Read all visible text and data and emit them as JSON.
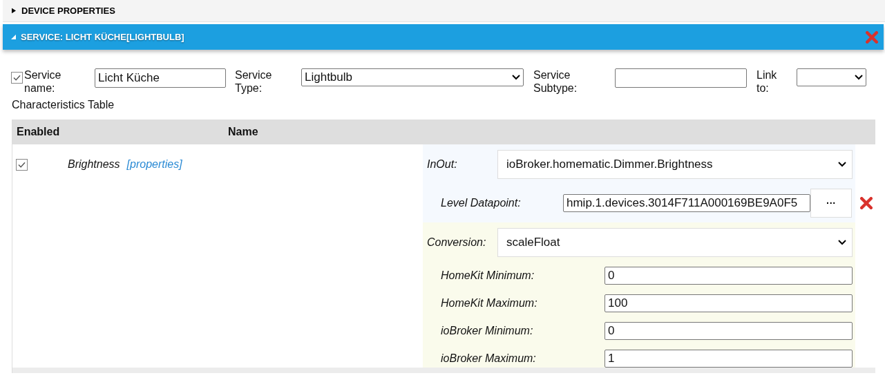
{
  "device_properties": {
    "title": "DEVICE PROPERTIES",
    "expanded": false
  },
  "service": {
    "title": "SERVICE: LICHT KÜCHE[LIGHTBULB]",
    "expanded": true
  },
  "form": {
    "enabled": true,
    "name_label": "Service name:",
    "name_value": "Licht Küche",
    "type_label": "Service Type:",
    "type_value": "Lightbulb",
    "subtype_label": "Service Subtype:",
    "link_label": "Link to:"
  },
  "table": {
    "title": "Characteristics Table",
    "columns": [
      "Enabled",
      "Name"
    ],
    "rows": [
      {
        "enabled": true,
        "name": "Brightness",
        "link": "[properties]",
        "inout_label": "InOut:",
        "inout_value": "ioBroker.homematic.Dimmer.Brightness",
        "datapoint_label": "Level Datapoint:",
        "datapoint_value": "hmip.1.devices.3014F711A000169BE9A0F5",
        "browse": "···",
        "conversion_label": "Conversion:",
        "conversion_value": "scaleFloat",
        "params": [
          {
            "label": "HomeKit Minimum:",
            "value": "0"
          },
          {
            "label": "HomeKit Maximum:",
            "value": "100"
          },
          {
            "label": "ioBroker Minimum:",
            "value": "0"
          },
          {
            "label": "ioBroker Maximum:",
            "value": "1"
          }
        ]
      }
    ]
  }
}
